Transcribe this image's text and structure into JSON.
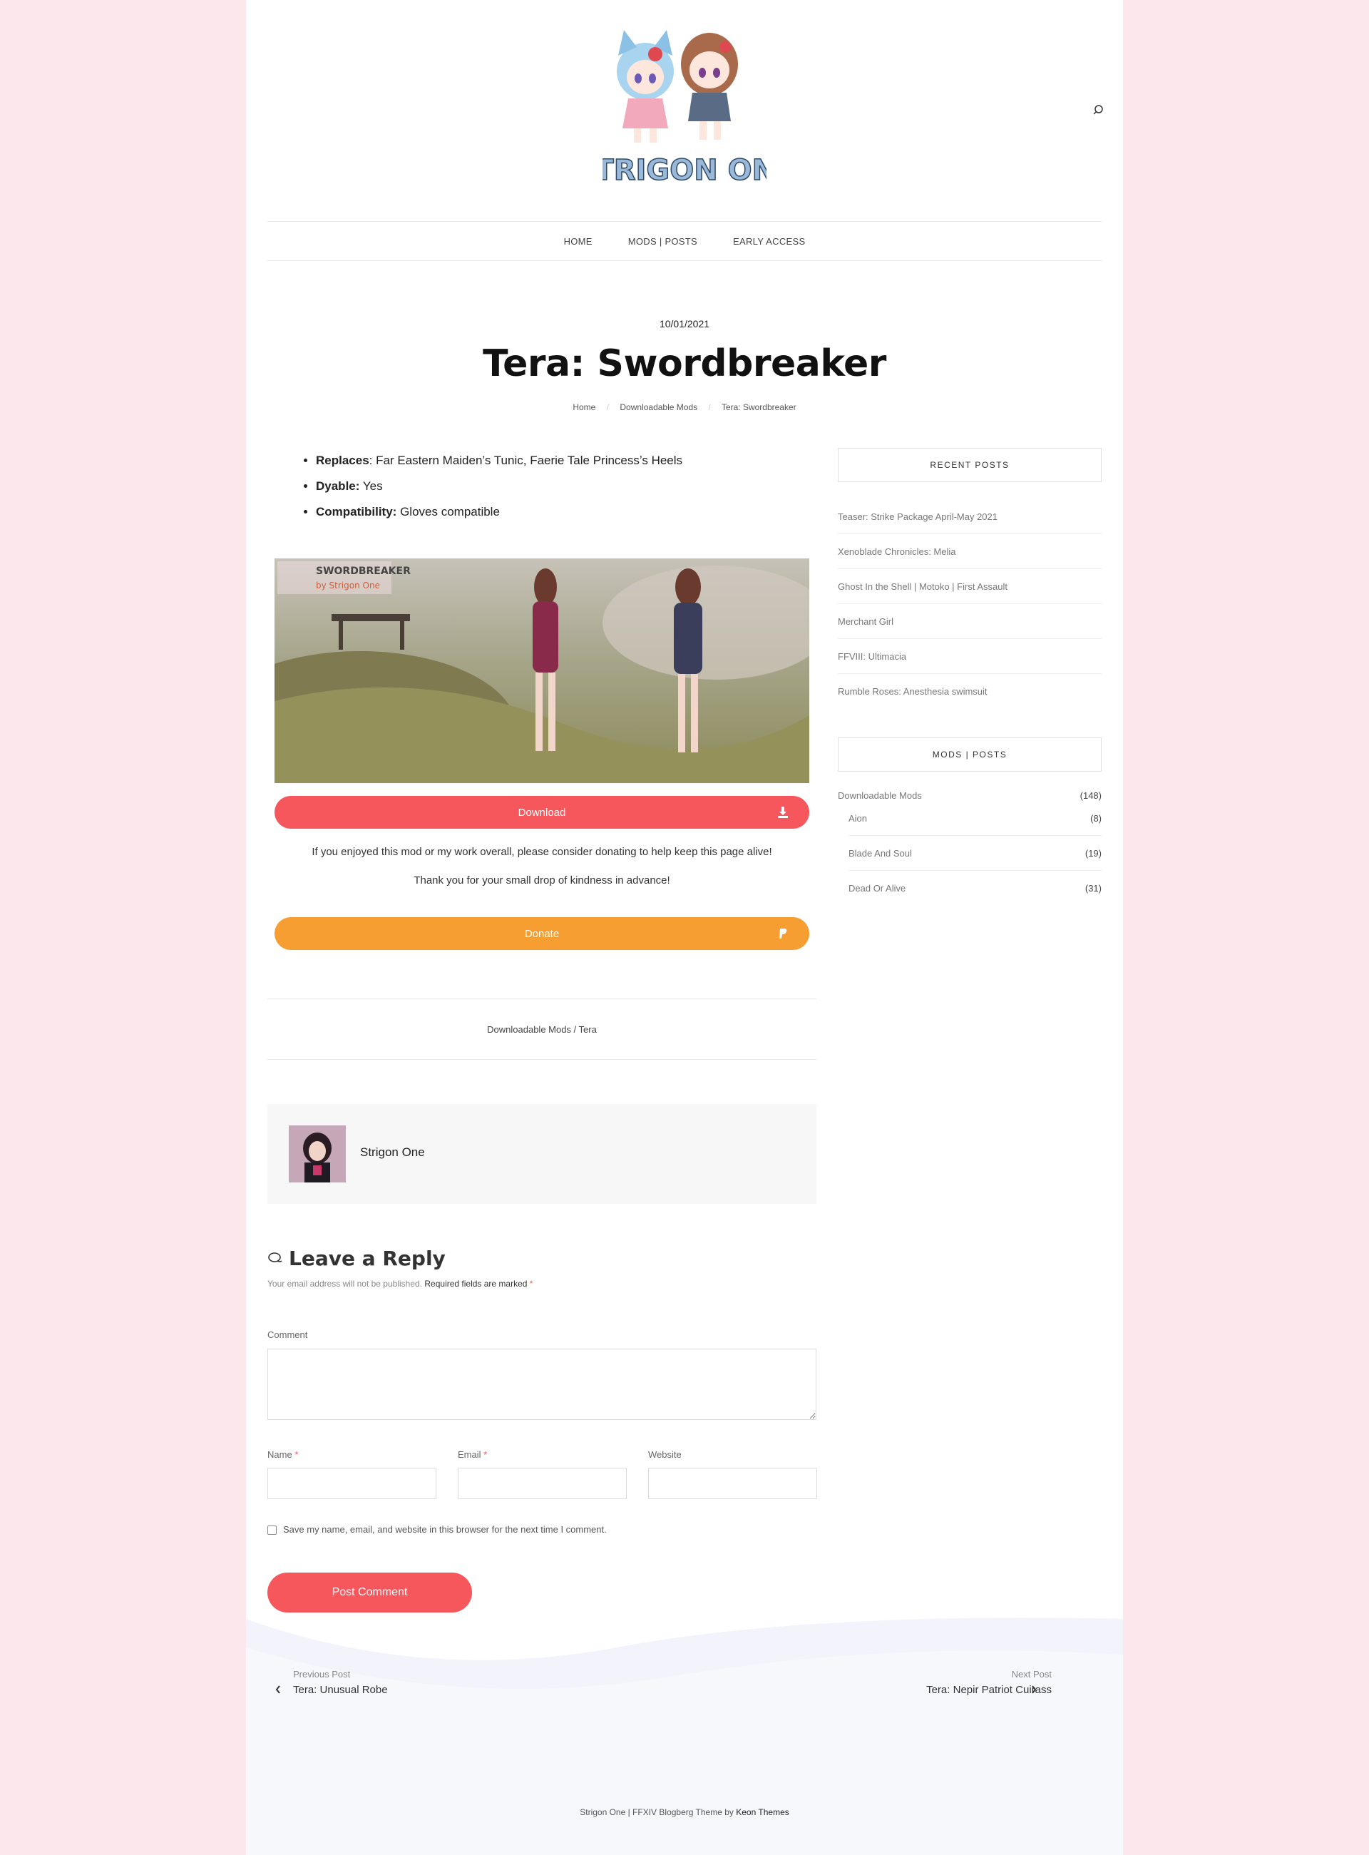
{
  "header": {
    "logo_text": "STRIGON ONE",
    "nav": [
      "HOME",
      "MODS | POSTS",
      "EARLY ACCESS"
    ]
  },
  "post": {
    "date": "10/01/2021",
    "title": "Tera: Swordbreaker",
    "breadcrumb": [
      "Home",
      "Downloadable Mods",
      "Tera: Swordbreaker"
    ],
    "specs": [
      {
        "key": "Replaces",
        "sep": ":",
        "value": " Far Eastern Maiden’s Tunic, Faerie Tale Princess’s Heels"
      },
      {
        "key": "Dyable:",
        "sep": "",
        "value": " Yes"
      },
      {
        "key": "Compatibility:",
        "sep": "",
        "value": " Gloves compatible"
      }
    ],
    "image_caption_title": "SWORDBREAKER",
    "image_caption_sub": "by Strigon One",
    "download_label": "Download",
    "donate_message": "If you enjoyed this mod or my work overall, please consider donating to help keep this page alive!",
    "thanks_message": "Thank you for your small drop of kindness in advance!",
    "donate_label": "Donate",
    "tags": "Downloadable Mods / Tera",
    "author": "Strigon One"
  },
  "reply": {
    "heading": "Leave a Reply",
    "note": "Your email address will not be published.",
    "note_required": "Required fields are marked",
    "star": "*",
    "comment_label": "Comment",
    "name_label": "Name",
    "email_label": "Email",
    "website_label": "Website",
    "save_label": "Save my name, email, and website in this browser for the next time I comment.",
    "submit_label": "Post Comment"
  },
  "sidebar": {
    "recent_title": "RECENT POSTS",
    "recent": [
      "Teaser: Strike Package April-May 2021",
      "Xenoblade Chronicles: Melia",
      "Ghost In the Shell | Motoko | First Assault",
      "Merchant Girl",
      "FFVIII: Ultimacia",
      "Rumble Roses: Anesthesia swimsuit"
    ],
    "cats_title": "MODS | POSTS",
    "cat_parent": {
      "name": "Downloadable Mods",
      "count": "(148)"
    },
    "cats": [
      {
        "name": "Aion",
        "count": "(8)"
      },
      {
        "name": "Blade And Soul",
        "count": "(19)"
      },
      {
        "name": "Dead Or Alive",
        "count": "(31)"
      }
    ]
  },
  "post_nav": {
    "prev_label": "Previous Post",
    "prev_title": "Tera: Unusual Robe",
    "next_label": "Next Post",
    "next_title": "Tera: Nepir Patriot Cuirass"
  },
  "footer": {
    "text": "Strigon One | FFXIV Blogberg Theme by",
    "brand": "Keon Themes"
  },
  "colors": {
    "background": "#fce8ec",
    "accent": "#f6575d",
    "donate": "#f79e33"
  }
}
